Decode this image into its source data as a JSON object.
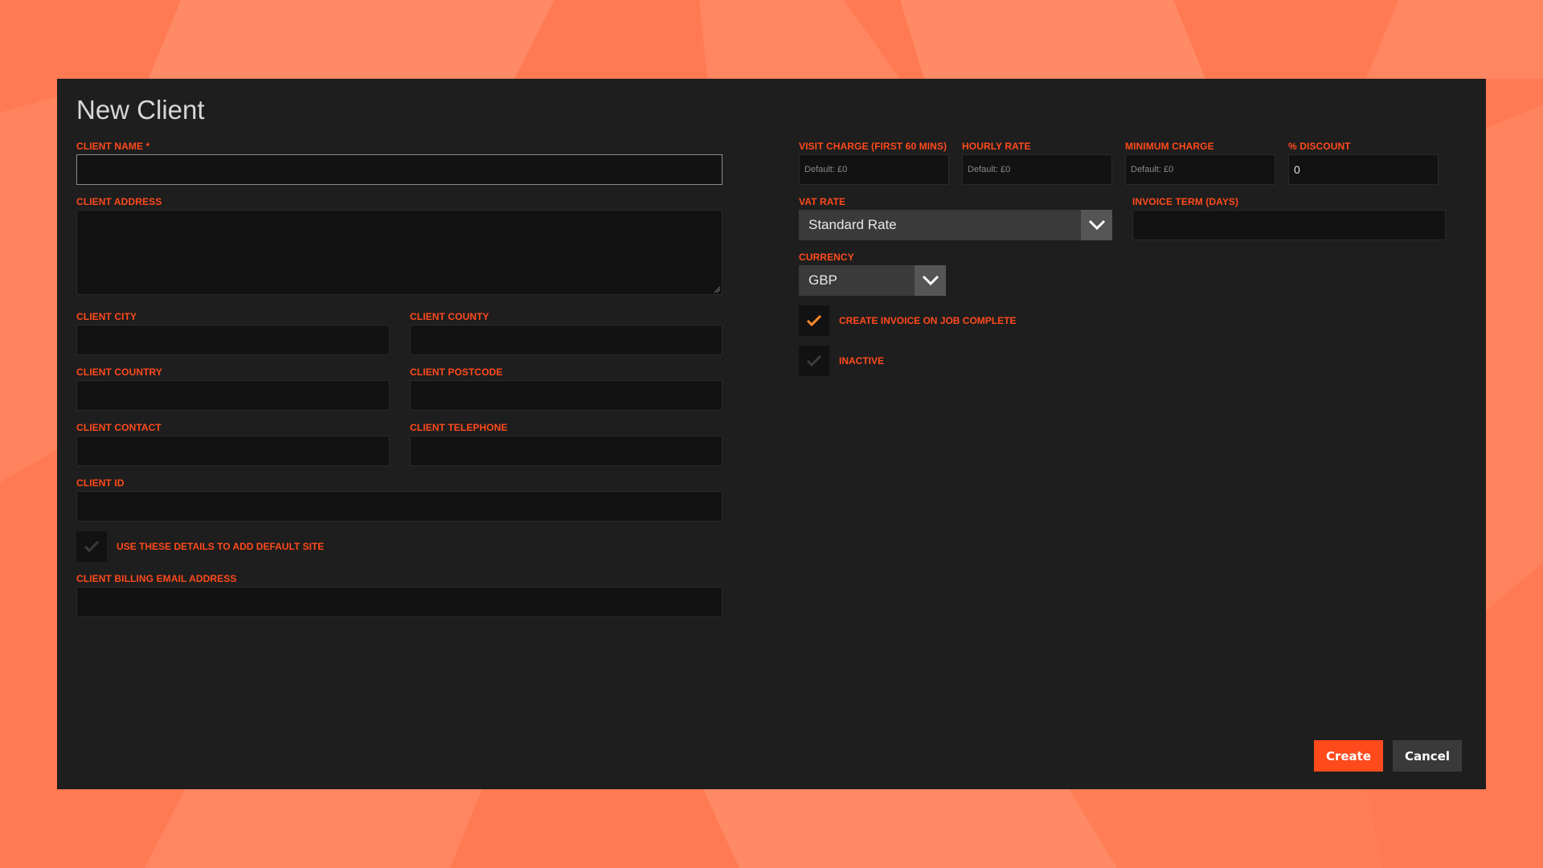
{
  "colors": {
    "accent": "#ff4a1c",
    "background": "#ff7a52",
    "panel": "#1e1e1e",
    "input": "#121212"
  },
  "dialog": {
    "title": "New Client"
  },
  "left": {
    "client_name": {
      "label": "CLIENT NAME *",
      "value": ""
    },
    "client_address": {
      "label": "CLIENT ADDRESS",
      "value": ""
    },
    "client_city": {
      "label": "CLIENT CITY",
      "value": ""
    },
    "client_county": {
      "label": "CLIENT COUNTY",
      "value": ""
    },
    "client_country": {
      "label": "CLIENT COUNTRY",
      "value": ""
    },
    "client_postcode": {
      "label": "CLIENT POSTCODE",
      "value": ""
    },
    "client_contact": {
      "label": "CLIENT CONTACT",
      "value": ""
    },
    "client_telephone": {
      "label": "CLIENT TELEPHONE",
      "value": ""
    },
    "client_id": {
      "label": "CLIENT ID",
      "value": ""
    },
    "default_site": {
      "label": "USE THESE DETAILS TO ADD DEFAULT SITE",
      "checked": false
    },
    "billing_email": {
      "label": "CLIENT BILLING EMAIL ADDRESS",
      "value": ""
    }
  },
  "right": {
    "visit_charge": {
      "label": "VISIT CHARGE (FIRST 60 MINS)",
      "placeholder": "Default: £0"
    },
    "hourly_rate": {
      "label": "HOURLY RATE",
      "placeholder": "Default: £0"
    },
    "minimum_charge": {
      "label": "MINIMUM CHARGE",
      "placeholder": "Default: £0"
    },
    "discount": {
      "label": "% DISCOUNT",
      "value": "0"
    },
    "vat_rate": {
      "label": "VAT RATE",
      "value": "Standard Rate"
    },
    "invoice_term": {
      "label": "INVOICE TERM (DAYS)",
      "value": ""
    },
    "currency": {
      "label": "CURRENCY",
      "value": "GBP"
    },
    "create_invoice": {
      "label": "CREATE INVOICE ON JOB COMPLETE",
      "checked": true
    },
    "inactive": {
      "label": "INACTIVE",
      "checked": false
    }
  },
  "buttons": {
    "create": "Create",
    "cancel": "Cancel"
  }
}
